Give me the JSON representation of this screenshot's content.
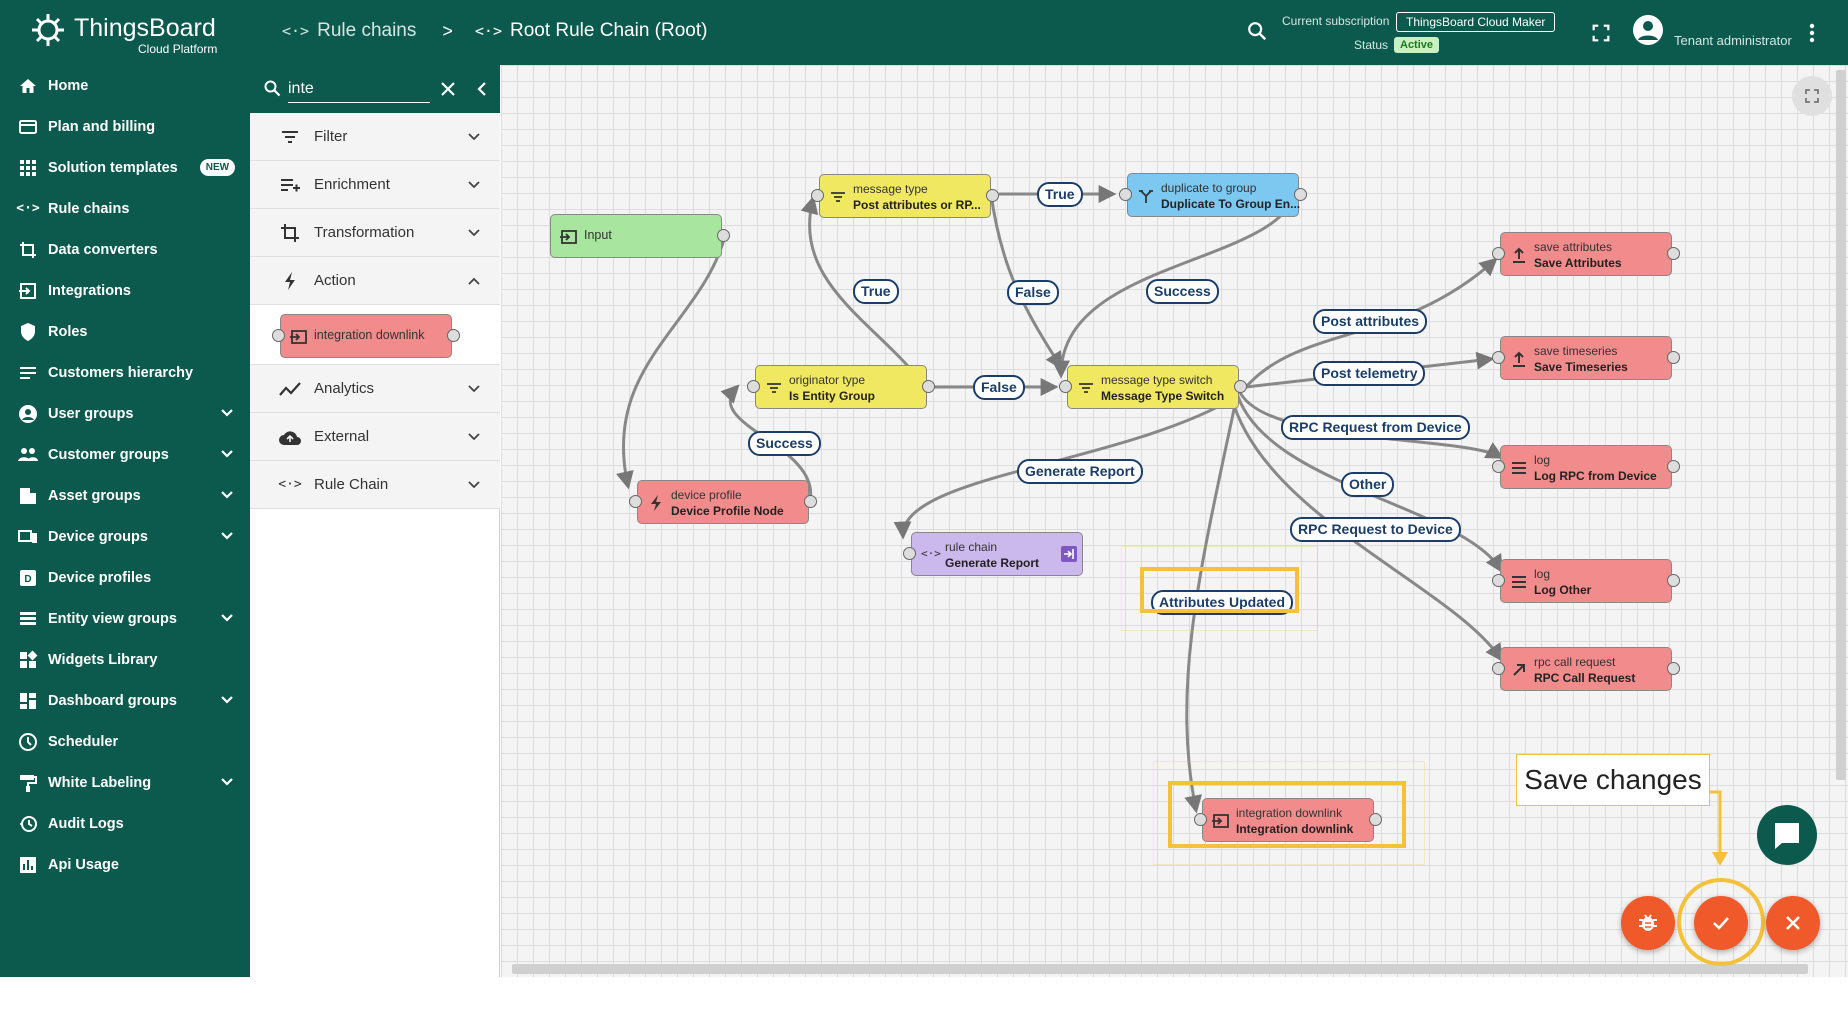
{
  "app": {
    "logo_title": "ThingsBoard",
    "logo_subtitle": "Cloud Platform"
  },
  "breadcrumb": [
    {
      "label": "Rule chains",
      "icon": "rule-chain-icon"
    },
    {
      "separator": ">"
    },
    {
      "label": "Root Rule Chain (Root)",
      "icon": "rule-chain-icon"
    }
  ],
  "header": {
    "subscription_label": "Current subscription",
    "subscription_value": "ThingsBoard Cloud Maker",
    "status_label": "Status",
    "status_value": "Active",
    "user_role": "Tenant administrator"
  },
  "sidebar": {
    "items": [
      {
        "label": "Home",
        "icon": "home-icon",
        "expandable": false
      },
      {
        "label": "Plan and billing",
        "icon": "billing-icon",
        "expandable": false
      },
      {
        "label": "Solution templates",
        "icon": "apps-icon",
        "badge": "NEW",
        "expandable": false
      },
      {
        "label": "Rule chains",
        "icon": "rule-chain-icon",
        "expandable": false
      },
      {
        "label": "Data converters",
        "icon": "converter-icon",
        "expandable": false
      },
      {
        "label": "Integrations",
        "icon": "integration-icon",
        "expandable": false
      },
      {
        "label": "Roles",
        "icon": "shield-icon",
        "expandable": false
      },
      {
        "label": "Customers hierarchy",
        "icon": "hierarchy-icon",
        "expandable": false
      },
      {
        "label": "User groups",
        "icon": "user-icon",
        "expandable": true
      },
      {
        "label": "Customer groups",
        "icon": "group-icon",
        "expandable": true
      },
      {
        "label": "Asset groups",
        "icon": "asset-icon",
        "expandable": true
      },
      {
        "label": "Device groups",
        "icon": "device-icon",
        "expandable": true
      },
      {
        "label": "Device profiles",
        "icon": "device-profile-icon",
        "expandable": false
      },
      {
        "label": "Entity view groups",
        "icon": "entity-view-icon",
        "expandable": true
      },
      {
        "label": "Widgets Library",
        "icon": "widgets-icon",
        "expandable": false
      },
      {
        "label": "Dashboard groups",
        "icon": "dashboard-icon",
        "expandable": true
      },
      {
        "label": "Scheduler",
        "icon": "clock-icon",
        "expandable": false
      },
      {
        "label": "White Labeling",
        "icon": "paint-roller-icon",
        "expandable": true
      },
      {
        "label": "Audit Logs",
        "icon": "audit-icon",
        "expandable": false
      },
      {
        "label": "Api Usage",
        "icon": "chart-icon",
        "expandable": false
      }
    ]
  },
  "library": {
    "search_value": "inte",
    "categories": [
      {
        "label": "Filter",
        "icon": "filter-icon",
        "expanded": false
      },
      {
        "label": "Enrichment",
        "icon": "enrichment-icon",
        "expanded": false
      },
      {
        "label": "Transformation",
        "icon": "transform-icon",
        "expanded": false
      },
      {
        "label": "Action",
        "icon": "bolt-icon",
        "expanded": true
      },
      {
        "label": "Analytics",
        "icon": "analytics-icon",
        "expanded": false
      },
      {
        "label": "External",
        "icon": "cloud-icon",
        "expanded": false
      },
      {
        "label": "Rule Chain",
        "icon": "rule-chain-icon",
        "expanded": false
      }
    ],
    "action_node": {
      "label": "integration downlink",
      "icon": "integration-icon"
    }
  },
  "nodes": {
    "input": {
      "label": "Input"
    },
    "msg_type_filter": {
      "type": "message type",
      "name": "Post attributes or RP..."
    },
    "duplicate": {
      "type": "duplicate to group",
      "name": "Duplicate To Group En..."
    },
    "save_attributes": {
      "type": "save attributes",
      "name": "Save Attributes"
    },
    "save_timeseries": {
      "type": "save timeseries",
      "name": "Save Timeseries"
    },
    "originator_type": {
      "type": "originator type",
      "name": "Is Entity Group"
    },
    "msg_type_switch": {
      "type": "message type switch",
      "name": "Message Type Switch"
    },
    "log_rpc": {
      "type": "log",
      "name": "Log RPC from Device"
    },
    "log_other": {
      "type": "log",
      "name": "Log Other"
    },
    "rpc_call": {
      "type": "rpc call request",
      "name": "RPC Call Request"
    },
    "device_profile": {
      "type": "device profile",
      "name": "Device Profile Node"
    },
    "rule_chain": {
      "type": "rule chain",
      "name": "Generate Report"
    },
    "integration_downlink": {
      "type": "integration downlink",
      "name": "Integration downlink"
    }
  },
  "edge_labels": {
    "true_top": "True",
    "true_left": "True",
    "false_top": "False",
    "false_mid": "False",
    "success_top": "Success",
    "success_left": "Success",
    "post_attributes": "Post attributes",
    "post_telemetry": "Post telemetry",
    "rpc_from_device": "RPC Request from Device",
    "other": "Other",
    "rpc_to_device": "RPC Request to Device",
    "generate_report": "Generate Report",
    "attributes_updated": "Attributes Updated"
  },
  "callout": {
    "text": "Save changes"
  },
  "colors": {
    "primary": "#0b5a4d",
    "highlight": "#f3c13a",
    "fab": "#f05a2a",
    "node_red": "#f28b8b",
    "node_yellow": "#f1e861",
    "node_blue": "#7cc8f0",
    "node_green": "#a8e6a0",
    "node_purple": "#cbb8ec",
    "edge_label": "#1a3d6a"
  }
}
